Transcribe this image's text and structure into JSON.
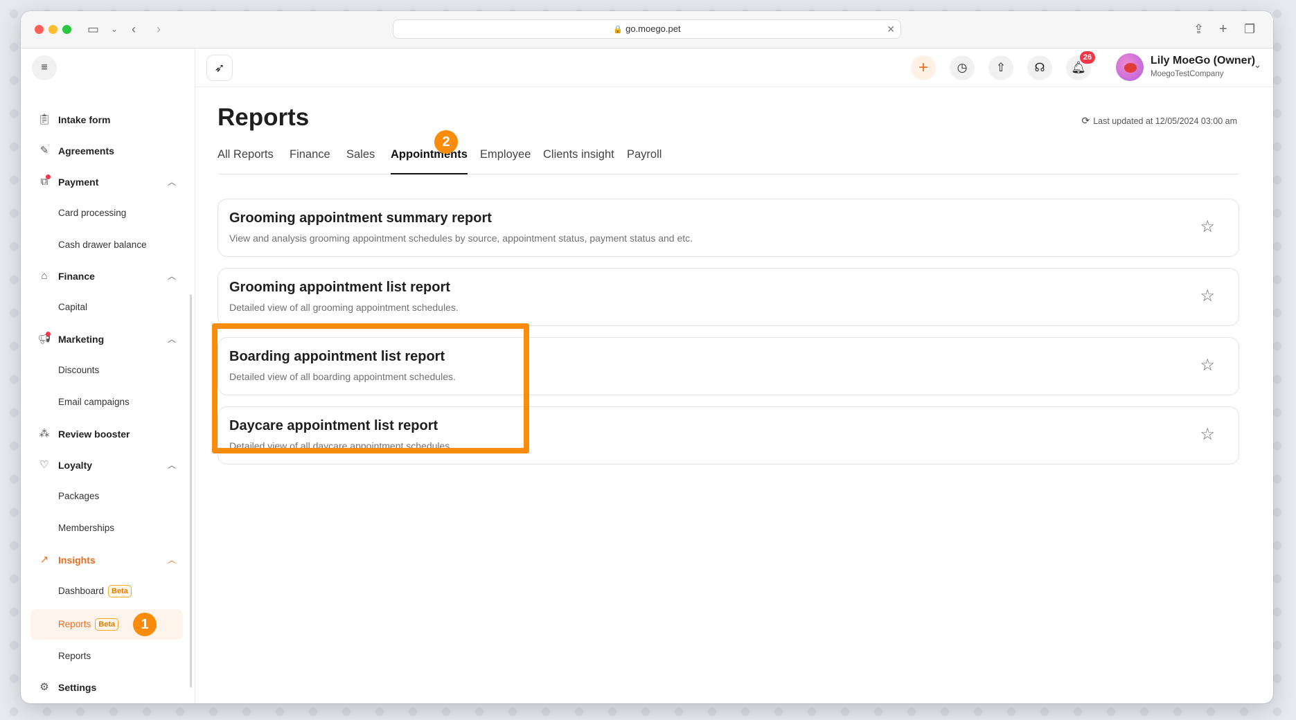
{
  "browser": {
    "url": "go.moego.pet"
  },
  "sidebar": {
    "items": [
      {
        "label": "Intake form",
        "icon": "clipboard-icon"
      },
      {
        "label": "Agreements",
        "icon": "pen-icon"
      },
      {
        "label": "Payment",
        "icon": "payment-icon"
      },
      {
        "label": "Card processing"
      },
      {
        "label": "Cash drawer balance"
      },
      {
        "label": "Finance",
        "icon": "bank-icon"
      },
      {
        "label": "Capital"
      },
      {
        "label": "Marketing",
        "icon": "megaphone-icon"
      },
      {
        "label": "Discounts"
      },
      {
        "label": "Email campaigns"
      },
      {
        "label": "Review booster",
        "icon": "review-icon"
      },
      {
        "label": "Loyalty",
        "icon": "heart-icon"
      },
      {
        "label": "Packages"
      },
      {
        "label": "Memberships"
      },
      {
        "label": "Insights",
        "icon": "chart-line-icon"
      },
      {
        "label": "Dashboard",
        "badge": "Beta"
      },
      {
        "label": "Reports",
        "badge": "Beta"
      },
      {
        "label": "Reports"
      },
      {
        "label": "Settings",
        "icon": "gear-icon"
      }
    ]
  },
  "markers": {
    "one": "1",
    "two": "2"
  },
  "topbar": {
    "notifications_count": "26",
    "user_name": "Lily MoeGo (Owner)",
    "company": "MoegoTestCompany"
  },
  "main": {
    "title": "Reports",
    "last_updated": "Last updated at 12/05/2024 03:00 am",
    "tabs": [
      {
        "label": "All Reports"
      },
      {
        "label": "Finance"
      },
      {
        "label": "Sales"
      },
      {
        "label": "Appointments"
      },
      {
        "label": "Employee"
      },
      {
        "label": "Clients insight"
      },
      {
        "label": "Payroll"
      }
    ],
    "active_tab": "Appointments",
    "reports": [
      {
        "title": "Grooming appointment summary report",
        "description": "View and analysis grooming appointment schedules by source, appointment status, payment status and etc."
      },
      {
        "title": "Grooming appointment list report",
        "description": "Detailed view of all grooming appointment schedules."
      },
      {
        "title": "Boarding appointment list report",
        "description": "Detailed view of all boarding appointment schedules."
      },
      {
        "title": "Daycare appointment list report",
        "description": "Detailed view of all daycare appointment schedules."
      }
    ]
  },
  "colors": {
    "accent": "#f06b1e",
    "highlight": "#fb8c0b",
    "badge_red": "#f0384a"
  }
}
